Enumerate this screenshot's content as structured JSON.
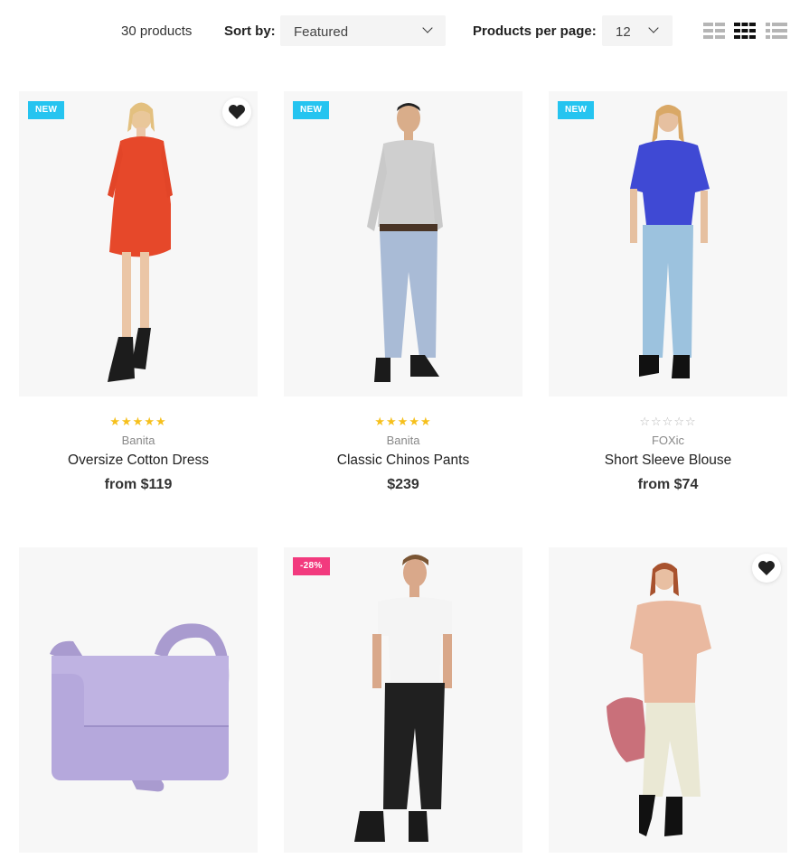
{
  "toolbar": {
    "count": "30 products",
    "sort_label": "Sort by:",
    "sort_value": "Featured",
    "per_page_label": "Products per page:",
    "per_page_value": "12",
    "views": [
      "grid-2-icon",
      "grid-3-icon",
      "list-icon"
    ],
    "active_view": "grid-3-icon"
  },
  "colors": {
    "badge_new": "#25c4f0",
    "badge_sale": "#f23a7e",
    "star": "#f6c01c",
    "card_bg": "#f7f7f7"
  },
  "products": [
    {
      "badge": "NEW",
      "wishlist": true,
      "rating": 5,
      "brand": "Banita",
      "title": "Oversize Cotton Dress",
      "price": "from $119",
      "image": "woman-orange-dress"
    },
    {
      "badge": "NEW",
      "wishlist": false,
      "rating": 5,
      "brand": "Banita",
      "title": "Classic Chinos Pants",
      "price": "$239",
      "image": "man-grey-sweater-chinos"
    },
    {
      "badge": "NEW",
      "wishlist": false,
      "rating": 0,
      "brand": "FOXic",
      "title": "Short Sleeve Blouse",
      "price": "from $74",
      "image": "woman-blue-blouse-jeans"
    },
    {
      "badge": "",
      "wishlist": false,
      "image": "lavender-crossbody-bag"
    },
    {
      "badge": "-28%",
      "wishlist": false,
      "image": "man-white-tee-black-joggers"
    },
    {
      "badge": "",
      "wishlist": true,
      "image": "woman-peach-tee-cream-pants"
    }
  ]
}
